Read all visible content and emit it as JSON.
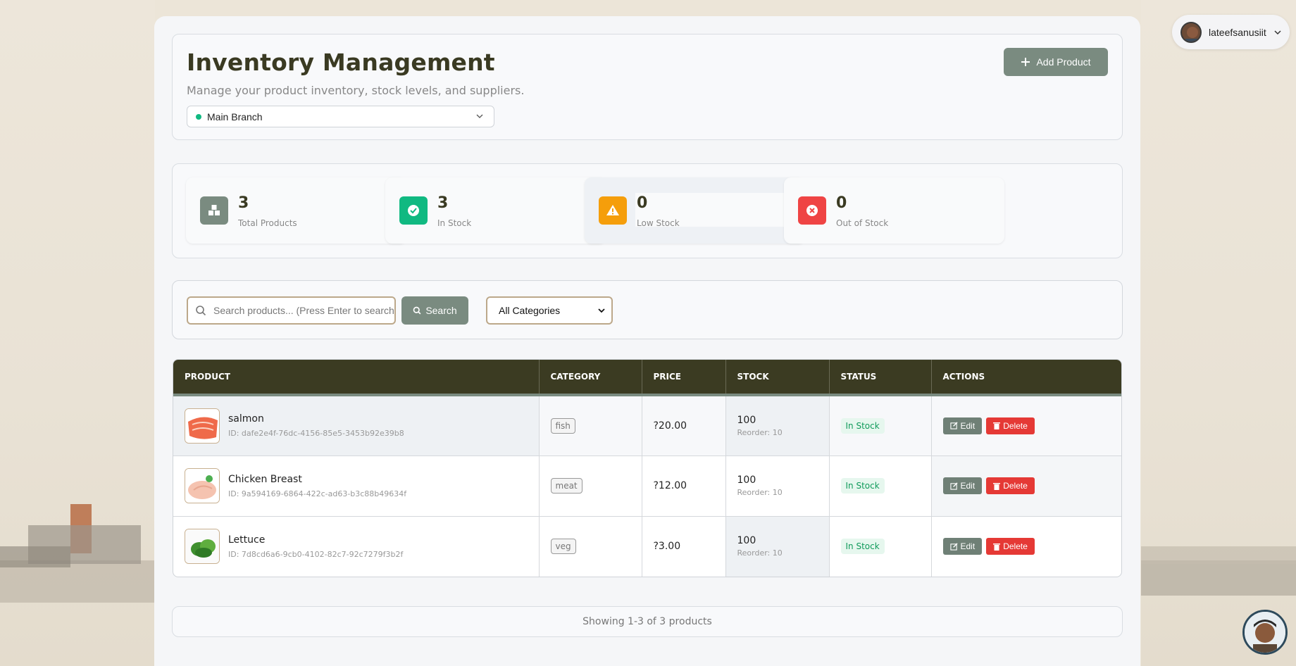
{
  "header": {
    "title": "Inventory Management",
    "subtitle": "Manage your product inventory, stock levels, and suppliers.",
    "branch": "Main Branch",
    "add_button": "Add Product"
  },
  "user": {
    "name": "lateefsanusiit"
  },
  "stats": [
    {
      "value": "3",
      "label": "Total Products",
      "color": "#7a8b80",
      "icon": "boxes-icon"
    },
    {
      "value": "3",
      "label": "In Stock",
      "color": "#10b981",
      "icon": "check-circle-icon"
    },
    {
      "value": "0",
      "label": "Low Stock",
      "color": "#f59e0b",
      "icon": "warning-icon"
    },
    {
      "value": "0",
      "label": "Out of Stock",
      "color": "#ef4444",
      "icon": "x-circle-icon"
    }
  ],
  "search": {
    "placeholder": "Search products... (Press Enter to search)",
    "button": "Search",
    "category": "All Categories"
  },
  "table": {
    "headers": [
      "PRODUCT",
      "CATEGORY",
      "PRICE",
      "STOCK",
      "STATUS",
      "ACTIONS"
    ],
    "rows": [
      {
        "name": "salmon",
        "id": "ID: dafe2e4f-76dc-4156-85e5-3453b92e39b8",
        "category": "fish",
        "price": "?20.00",
        "stock": "100",
        "reorder": "Reorder: 10",
        "status": "In Stock",
        "image": "salmon"
      },
      {
        "name": "Chicken Breast",
        "id": "ID: 9a594169-6864-422c-ad63-b3c88b49634f",
        "category": "meat",
        "price": "?12.00",
        "stock": "100",
        "reorder": "Reorder: 10",
        "status": "In Stock",
        "image": "chicken"
      },
      {
        "name": "Lettuce",
        "id": "ID: 7d8cd6a6-9cb0-4102-82c7-92c7279f3b2f",
        "category": "veg",
        "price": "?3.00",
        "stock": "100",
        "reorder": "Reorder: 10",
        "status": "In Stock",
        "image": "lettuce"
      }
    ],
    "edit_label": "Edit",
    "delete_label": "Delete"
  },
  "footer": {
    "text": "Showing 1-3 of 3 products"
  }
}
